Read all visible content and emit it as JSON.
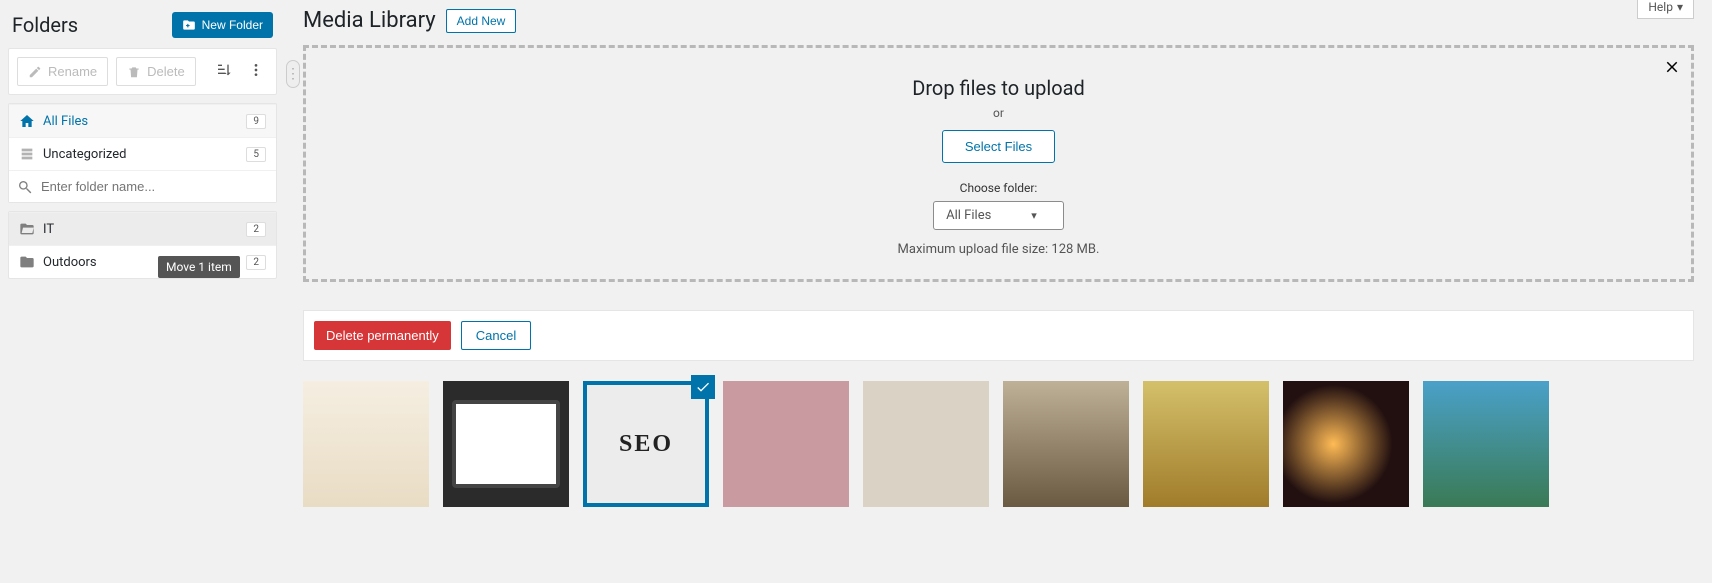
{
  "sidebar": {
    "title": "Folders",
    "new_folder_label": "New Folder",
    "rename_label": "Rename",
    "delete_label": "Delete",
    "search_placeholder": "Enter folder name...",
    "all_files": {
      "label": "All Files",
      "count": "9"
    },
    "uncategorized": {
      "label": "Uncategorized",
      "count": "5"
    },
    "folders": [
      {
        "label": "IT",
        "count": "2"
      },
      {
        "label": "Outdoors",
        "count": "2"
      }
    ],
    "drag_tooltip": "Move 1 item"
  },
  "header": {
    "title": "Media Library",
    "add_new_label": "Add New",
    "help_label": "Help"
  },
  "dropzone": {
    "title": "Drop files to upload",
    "or": "or",
    "select_label": "Select Files",
    "choose_label": "Choose folder:",
    "selected_folder": "All Files",
    "max_size": "Maximum upload file size: 128 MB."
  },
  "bulk": {
    "delete_label": "Delete permanently",
    "cancel_label": "Cancel"
  },
  "thumb_seo_text": "SEO"
}
